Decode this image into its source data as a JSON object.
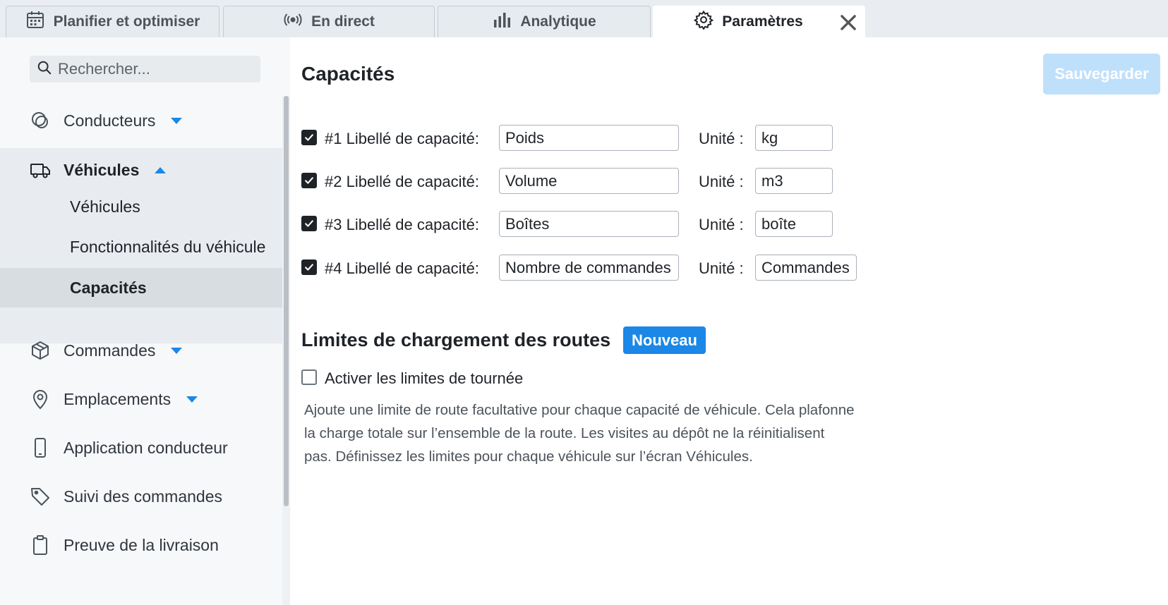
{
  "tabs": [
    {
      "label": "Planifier et optimiser",
      "icon": "calendar-icon"
    },
    {
      "label": "En direct",
      "icon": "broadcast-icon"
    },
    {
      "label": "Analytique",
      "icon": "bar-chart-icon"
    },
    {
      "label": "Paramètres",
      "icon": "gear-icon",
      "active": true
    }
  ],
  "sidebar": {
    "search_placeholder": "Rechercher...",
    "items": [
      {
        "label": "Conducteurs",
        "icon": "drivers-icon"
      },
      {
        "label": "Véhicules",
        "icon": "truck-icon"
      },
      {
        "label": "Commandes",
        "icon": "box-icon"
      },
      {
        "label": "Emplacements",
        "icon": "map-pin-icon"
      },
      {
        "label": "Application conducteur",
        "icon": "phone-icon"
      },
      {
        "label": "Suivi des commandes",
        "icon": "tag-icon"
      },
      {
        "label": "Preuve de la livraison",
        "icon": "clipboard-icon"
      }
    ],
    "vehicle_subitems": [
      "Véhicules",
      "Fonctionnalités du véhicule",
      "Capacités"
    ],
    "active_subitem": "Capacités"
  },
  "main": {
    "title": "Capacités",
    "save_label": "Sauvegarder",
    "unit_label": "Unité :",
    "capacities": [
      {
        "label": "#1 Libellé de capacité:",
        "value": "Poids",
        "unit": "kg",
        "checked": true
      },
      {
        "label": "#2 Libellé de capacité:",
        "value": "Volume",
        "unit": "m3",
        "checked": true
      },
      {
        "label": "#3 Libellé de capacité:",
        "value": "Boîtes",
        "unit": "boîte",
        "checked": true
      },
      {
        "label": "#4 Libellé de capacité:",
        "value": "Nombre de commandes",
        "unit": "Commandes",
        "checked": true
      }
    ],
    "route_limits": {
      "title": "Limites de chargement des routes",
      "badge": "Nouveau",
      "toggle_label": "Activer les limites de tournée",
      "toggle_checked": false,
      "description_lines": [
        "Ajoute une limite de route facultative pour chaque capacité de véhicule. Cela plafonne",
        "la charge totale sur l’ensemble de la route. Les visites au dépôt ne la réinitialisent",
        "pas. Définissez les limites pour chaque véhicule sur l’écran Véhicules."
      ]
    }
  },
  "colors": {
    "accent": "#1b87e6",
    "save_disabled": "#bfe0fb",
    "sidebar_bg": "#f6f8fa",
    "active_item_bg": "#d8dde2"
  }
}
